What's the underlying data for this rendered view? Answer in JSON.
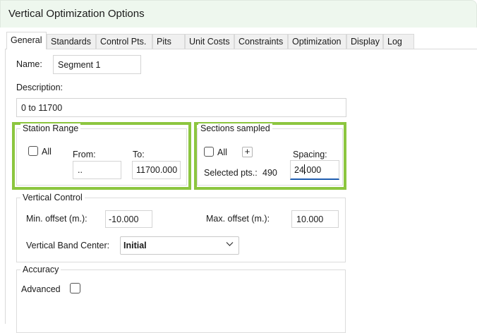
{
  "window": {
    "title": "Vertical Optimization Options"
  },
  "tabs": [
    {
      "label": "General"
    },
    {
      "label": "Standards"
    },
    {
      "label": "Control Pts."
    },
    {
      "label": "Pits"
    },
    {
      "label": "Unit Costs"
    },
    {
      "label": "Constraints"
    },
    {
      "label": "Optimization"
    },
    {
      "label": "Display"
    },
    {
      "label": "Log"
    }
  ],
  "general": {
    "name_label": "Name:",
    "name_value": "Segment 1",
    "description_label": "Description:",
    "description_value": "0 to 11700"
  },
  "station_range": {
    "title": "Station Range",
    "all_label": "All",
    "all_checked": false,
    "from_label": "From:",
    "from_value": "..",
    "to_label": "To:",
    "to_value": "11700.000"
  },
  "sections_sampled": {
    "title": "Sections sampled",
    "all_label": "All",
    "all_checked": false,
    "plus_label": "+",
    "selected_pts_label": "Selected pts.:",
    "selected_pts_value": "490",
    "spacing_label": "Spacing:",
    "spacing_value": "24.000"
  },
  "vertical_control": {
    "title": "Vertical Control",
    "min_offset_label": "Min. offset (m.):",
    "min_offset_value": "-10.000",
    "max_offset_label": "Max. offset (m.):",
    "max_offset_value": "10.000",
    "band_center_label": "Vertical Band Center:",
    "band_center_value": "Initial"
  },
  "accuracy": {
    "title": "Accuracy",
    "advanced_label": "Advanced",
    "advanced_checked": false
  },
  "colors": {
    "highlight": "#8cc63f",
    "focus_underline": "#1e5db0",
    "titlebar": "#eef7ee"
  }
}
